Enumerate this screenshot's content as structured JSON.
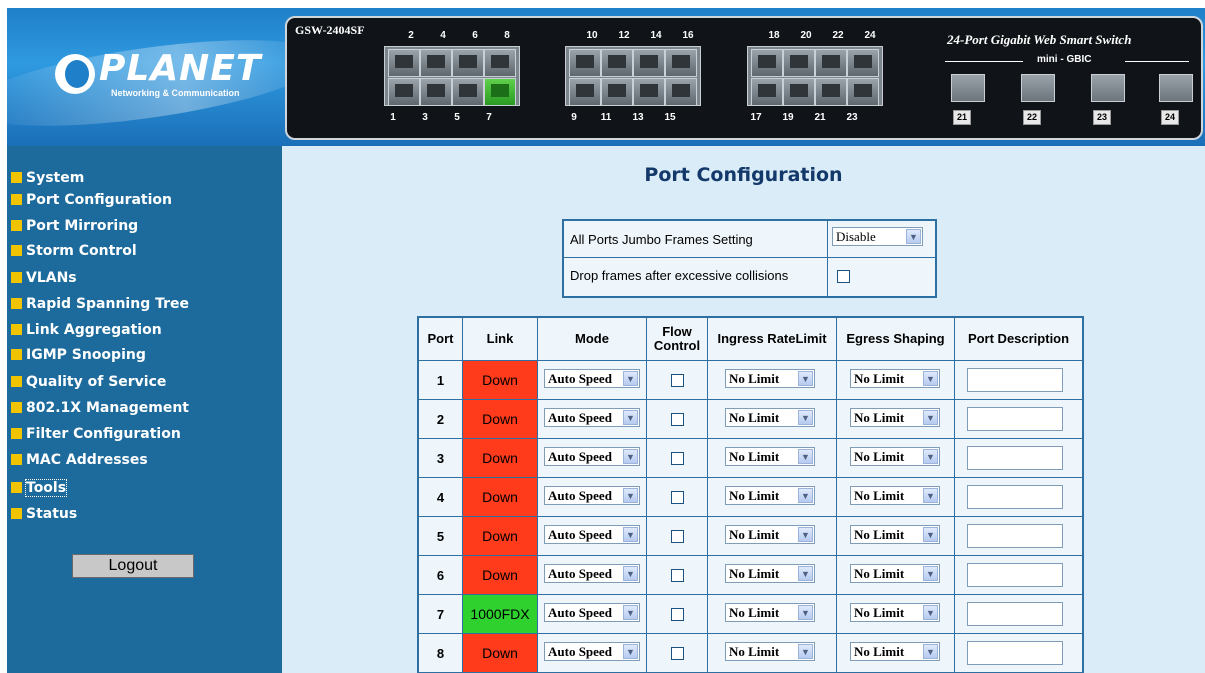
{
  "header": {
    "logo": {
      "name": "PLANET",
      "subtitle": "Networking & Communication"
    },
    "model": "GSW-2404SF",
    "description": "24-Port Gigabit Web Smart Switch",
    "mini_label": "mini - GBIC",
    "top_port_numbers": [
      "2",
      "4",
      "6",
      "8",
      "10",
      "12",
      "14",
      "16",
      "18",
      "20",
      "22",
      "24"
    ],
    "bottom_port_numbers": [
      "1",
      "3",
      "5",
      "7",
      "9",
      "11",
      "13",
      "15",
      "17",
      "19",
      "21",
      "23"
    ],
    "port_7_status_color": "#3cc83a",
    "sfp_ports": [
      "21",
      "22",
      "23",
      "24"
    ]
  },
  "sidebar": {
    "items": [
      {
        "label": "System"
      },
      {
        "label": "Port Configuration"
      },
      {
        "label": "Port Mirroring"
      },
      {
        "label": "Storm Control"
      },
      {
        "label": "VLANs"
      },
      {
        "label": "Rapid Spanning Tree"
      },
      {
        "label": "Link Aggregation"
      },
      {
        "label": "IGMP Snooping"
      },
      {
        "label": "Quality of Service"
      },
      {
        "label": "802.1X Management"
      },
      {
        "label": "Filter Configuration"
      },
      {
        "label": "MAC Addresses"
      },
      {
        "label": "Tools"
      },
      {
        "label": "Status"
      }
    ],
    "logout_label": "Logout"
  },
  "main": {
    "title": "Port Configuration",
    "jumbo": {
      "label": "All Ports Jumbo Frames Setting",
      "value": "Disable",
      "drop_label": "Drop frames after excessive collisions",
      "drop_checked": false
    },
    "table": {
      "headers": {
        "port": "Port",
        "link": "Link",
        "mode": "Mode",
        "flow_1": "Flow",
        "flow_2": "Control",
        "ingress": "Ingress RateLimit",
        "egress": "Egress Shaping",
        "desc": "Port Description"
      },
      "rows": [
        {
          "port": "1",
          "link": "Down",
          "mode": "Auto Speed",
          "ingress": "No Limit",
          "egress": "No Limit",
          "description": ""
        },
        {
          "port": "2",
          "link": "Down",
          "mode": "Auto Speed",
          "ingress": "No Limit",
          "egress": "No Limit",
          "description": ""
        },
        {
          "port": "3",
          "link": "Down",
          "mode": "Auto Speed",
          "ingress": "No Limit",
          "egress": "No Limit",
          "description": ""
        },
        {
          "port": "4",
          "link": "Down",
          "mode": "Auto Speed",
          "ingress": "No Limit",
          "egress": "No Limit",
          "description": ""
        },
        {
          "port": "5",
          "link": "Down",
          "mode": "Auto Speed",
          "ingress": "No Limit",
          "egress": "No Limit",
          "description": ""
        },
        {
          "port": "6",
          "link": "Down",
          "mode": "Auto Speed",
          "ingress": "No Limit",
          "egress": "No Limit",
          "description": ""
        },
        {
          "port": "7",
          "link": "1000FDX",
          "mode": "Auto Speed",
          "ingress": "No Limit",
          "egress": "No Limit",
          "description": ""
        },
        {
          "port": "8",
          "link": "Down",
          "mode": "Auto Speed",
          "ingress": "No Limit",
          "egress": "No Limit",
          "description": ""
        }
      ]
    },
    "colors": {
      "link_down": "#ff3b1c",
      "link_up": "#2fd12f",
      "title": "#13386a",
      "background": "#d9ecf7",
      "sidebar": "#1d6b9c"
    }
  }
}
